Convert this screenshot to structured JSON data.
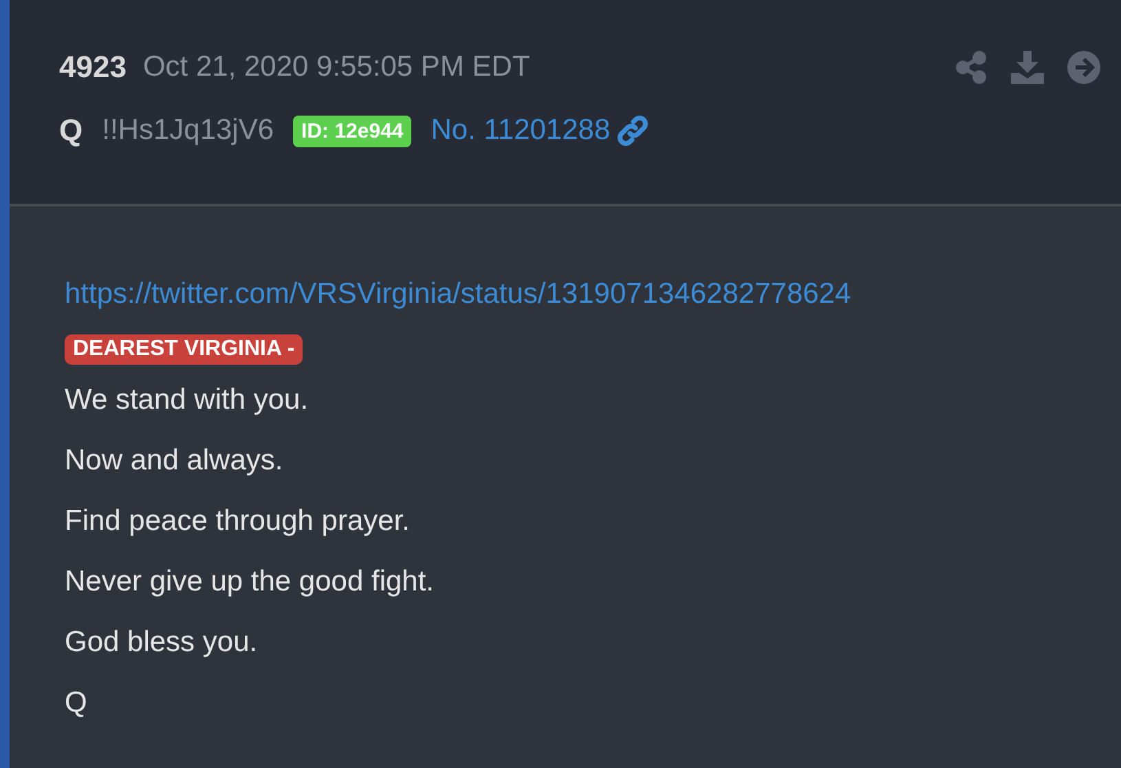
{
  "post": {
    "number": "4923",
    "timestamp": "Oct 21, 2020 9:55:05 PM EDT",
    "author": "Q",
    "tripcode": "!!Hs1Jq13jV6",
    "id_badge": "ID: 12e944",
    "post_link": "No. 11201288"
  },
  "body": {
    "link": "https://twitter.com/VRSVirginia/status/1319071346282778624",
    "highlight": "DEAREST VIRGINIA -",
    "lines": [
      "We stand with you.",
      "Now and always.",
      "Find peace through prayer.",
      "Never give up the good fight.",
      "God bless you.",
      "Q"
    ]
  }
}
